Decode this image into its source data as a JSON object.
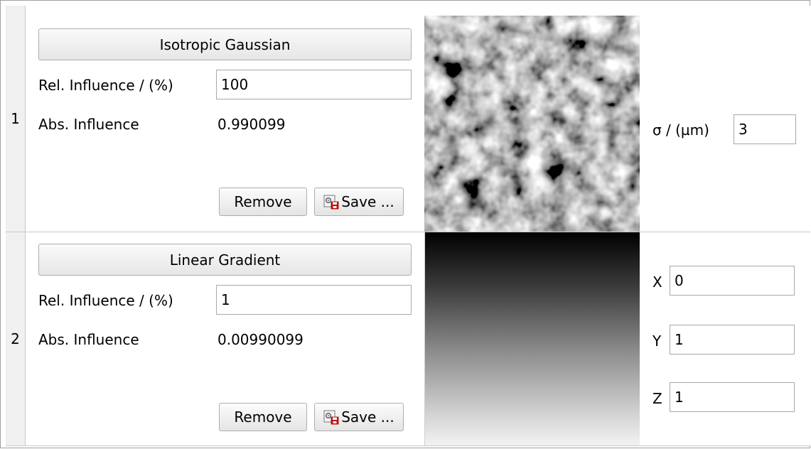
{
  "rows": [
    {
      "index": "1",
      "type_label": "Isotropic Gaussian",
      "rel_influence_label": "Rel. Influence / (%)",
      "rel_influence_value": "100",
      "abs_influence_label": "Abs. Influence",
      "abs_influence_value": "0.990099",
      "remove_label": "Remove",
      "save_label": "Save ...",
      "params": [
        {
          "label": "σ / (µm)",
          "value": "3"
        }
      ]
    },
    {
      "index": "2",
      "type_label": "Linear Gradient",
      "rel_influence_label": "Rel. Influence / (%)",
      "rel_influence_value": "1",
      "abs_influence_label": "Abs. Influence",
      "abs_influence_value": "0.00990099",
      "remove_label": "Remove",
      "save_label": "Save ...",
      "params": [
        {
          "label": "X",
          "value": "0"
        },
        {
          "label": "Y",
          "value": "1"
        },
        {
          "label": "Z",
          "value": "1"
        }
      ]
    }
  ],
  "icons": {
    "save": "save-settings-icon"
  },
  "colors": {
    "header_bg": "#f0f0f0",
    "button_border": "#adadad",
    "icon_red": "#d40000"
  }
}
